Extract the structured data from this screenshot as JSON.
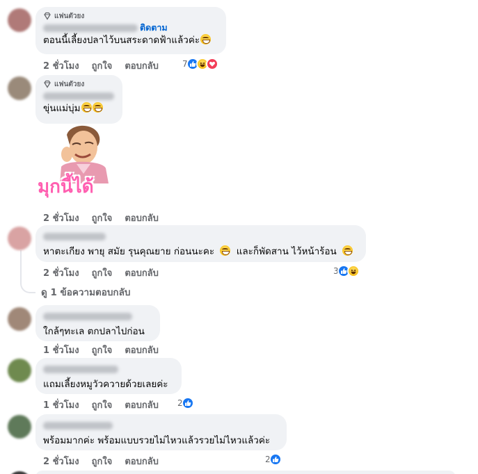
{
  "comments": [
    {
      "badge": "แฟนตัวยง",
      "follow": "ติดตาม",
      "text": "ตอนนี้เลี้ยงปลาไว้บนสระดาดฟ้าแล้วค่ะ",
      "time": "2 ชั่วโมง",
      "like": "ถูกใจ",
      "reply": "ตอบกลับ",
      "reaction_count": "7",
      "reactions": [
        "like-icon",
        "haha-icon",
        "love-icon"
      ]
    },
    {
      "badge": "แฟนตัวยง",
      "text": "ขุ่นแม่บุ่ม",
      "sticker_text": "มุกนี้ได้",
      "time": "2 ชั่วโมง",
      "like": "ถูกใจ",
      "reply": "ตอบกลับ"
    },
    {
      "text": "หาตะเกียง พายุ สมัย รุนคุณยาย ก่อนนะคะ",
      "text2": "และก็พัดสาน ไว้หน้าร้อน",
      "time": "2 ชั่วโมง",
      "like": "ถูกใจ",
      "reply": "ตอบกลับ",
      "reaction_count": "3",
      "reactions": [
        "like-icon",
        "haha-icon"
      ],
      "view_replies": "ดู 1 ข้อความตอบกลับ"
    },
    {
      "text": "ใกล้ๆทะเล ตกปลาไปก่อน",
      "time": "1 ชั่วโมง",
      "like": "ถูกใจ",
      "reply": "ตอบกลับ"
    },
    {
      "text": "แถมเลี้ยงหมูวัวควายด้วยเลยค่ะ",
      "time": "1 ชั่วโมง",
      "like": "ถูกใจ",
      "reply": "ตอบกลับ",
      "reaction_count": "2",
      "reactions": [
        "like-icon"
      ]
    },
    {
      "text": "พร้อมมากค่ะ พร้อมแบบรวยไม่ไหวแล้วรวยไม่ไหวแล้วค่ะ",
      "time": "2 ชั่วโมง",
      "like": "ถูกใจ",
      "reply": "ตอบกลับ",
      "reaction_count": "2",
      "reactions": [
        "like-icon"
      ]
    }
  ],
  "colors": {
    "bubble": "#f0f2f5",
    "meta_text": "#65676b",
    "link_blue": "#0064d1",
    "like_blue": "#1877f2",
    "love_red": "#f33e58",
    "sticker_pink": "#ff5fb0"
  }
}
